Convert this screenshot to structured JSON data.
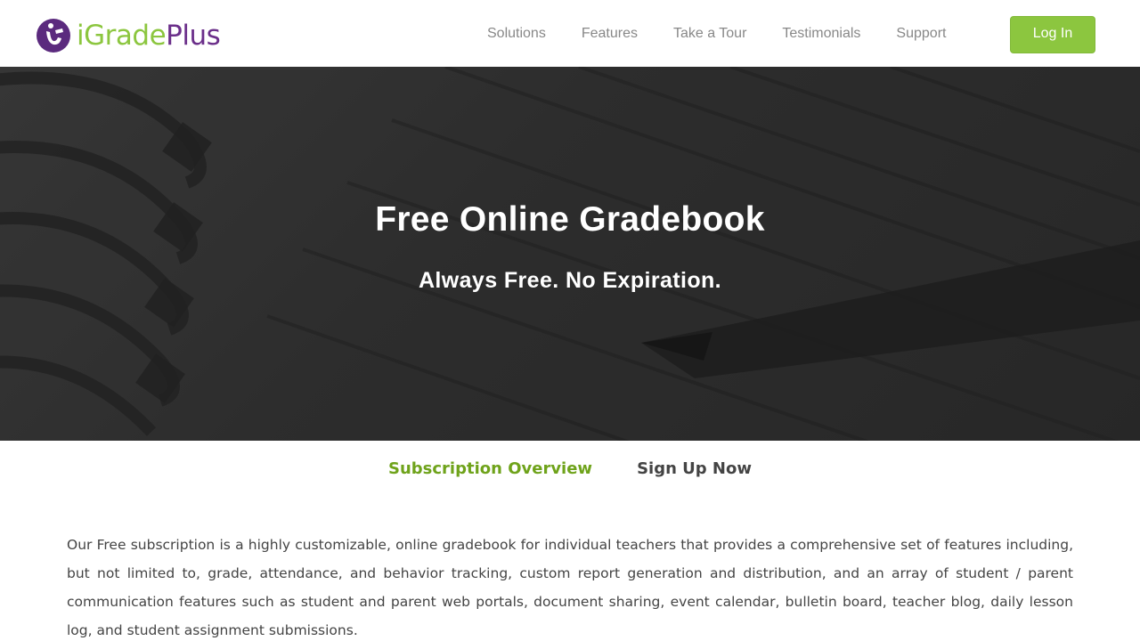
{
  "logo": {
    "prefix": "i",
    "mid": "Grade",
    "suffix": "Plus"
  },
  "nav": [
    {
      "label": "Solutions"
    },
    {
      "label": "Features"
    },
    {
      "label": "Take a Tour"
    },
    {
      "label": "Testimonials"
    },
    {
      "label": "Support"
    }
  ],
  "login_label": "Log In",
  "hero": {
    "title": "Free Online Gradebook",
    "subtitle": "Always Free. No Expiration."
  },
  "tabs": [
    {
      "label": "Subscription Overview",
      "active": true
    },
    {
      "label": "Sign Up Now",
      "active": false
    }
  ],
  "body_text": "Our Free subscription is a highly customizable, online gradebook for individual teachers that provides a comprehensive set of features including, but not limited to, grade, attendance, and behavior tracking, custom report generation and distribution, and an array of student / parent communication features such as student and parent web portals, document sharing, event calendar, bulletin board, teacher blog, daily lesson log, and student assignment submissions.",
  "colors": {
    "brand_green": "#8cc63f",
    "brand_purple": "#6b2f8a",
    "active_tab": "#6fa31b"
  }
}
